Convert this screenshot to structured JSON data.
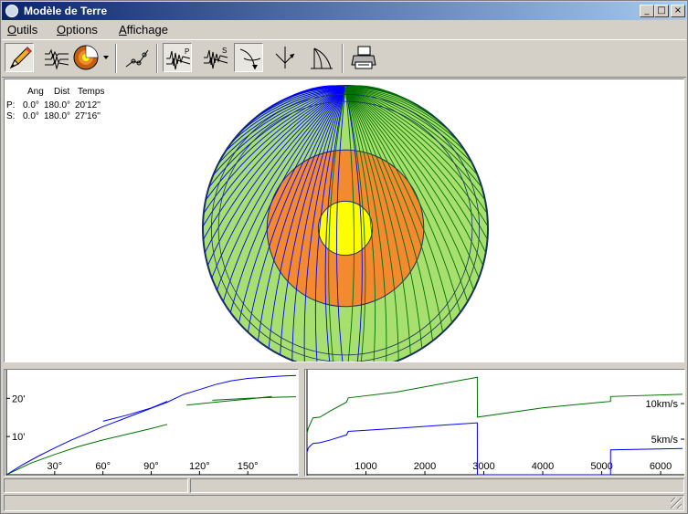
{
  "window": {
    "title": "Modèle de Terre"
  },
  "title_buttons": {
    "minimize": "_",
    "maximize": "□",
    "close": "×"
  },
  "menu": {
    "items": [
      {
        "label": "Outils"
      },
      {
        "label": "Options"
      },
      {
        "label": "Affichage"
      }
    ]
  },
  "toolbar": {
    "buttons": [
      {
        "icon": "pencil-icon"
      },
      {
        "icon": "seismogram-icon"
      },
      {
        "icon": "earth-cross-section-icon"
      },
      {
        "icon": "ray-fit-icon"
      },
      {
        "icon": "seismogram-p-icon"
      },
      {
        "icon": "seismogram-s-icon"
      },
      {
        "icon": "ray-path-icon"
      },
      {
        "icon": "ray-reflection-icon"
      },
      {
        "icon": "ray-fan-icon"
      },
      {
        "icon": "printer-icon"
      }
    ]
  },
  "info": {
    "header": {
      "ang": "Ang",
      "dist": "Dist",
      "temps": "Temps"
    },
    "rows": [
      {
        "phase": "P:",
        "ang": "0.0°",
        "dist": "180.0°",
        "temps": "20'12''"
      },
      {
        "phase": "S:",
        "ang": "0.0°",
        "dist": "180.0°",
        "temps": "27'16''"
      }
    ]
  },
  "earth_model": {
    "colors": {
      "mantle": "#a8e070",
      "outer_core": "#f48a30",
      "inner_core": "#ffff00",
      "p_rays": "#0000ff",
      "s_rays": "#007000",
      "outline": "#1a3060"
    }
  },
  "chart_data": [
    {
      "type": "line",
      "title": "",
      "x_ticks": [
        "30°",
        "60°",
        "90°",
        "120°",
        "150°"
      ],
      "y_ticks": [
        "10'",
        "20'"
      ],
      "xlim": [
        0,
        180
      ],
      "ylim": [
        0,
        27
      ],
      "series": [
        {
          "color": "#0000ff",
          "points": [
            [
              0,
              0
            ],
            [
              10,
              2.6
            ],
            [
              20,
              4.9
            ],
            [
              30,
              7
            ],
            [
              40,
              9
            ],
            [
              50,
              10.8
            ],
            [
              60,
              12.6
            ],
            [
              70,
              14.2
            ],
            [
              80,
              15.8
            ],
            [
              90,
              17.4
            ],
            [
              100,
              19
            ],
            [
              110,
              21
            ],
            [
              120,
              22.3
            ],
            [
              130,
              23.6
            ],
            [
              140,
              24.6
            ],
            [
              150,
              25.2
            ],
            [
              160,
              25.5
            ],
            [
              170,
              25.8
            ],
            [
              180,
              26
            ]
          ]
        },
        {
          "color": "#0000ff",
          "points": [
            [
              60,
              14
            ],
            [
              75,
              15.6
            ],
            [
              90,
              17.5
            ],
            [
              100,
              19.2
            ]
          ]
        },
        {
          "color": "#007000",
          "points": [
            [
              0,
              0
            ],
            [
              15,
              3
            ],
            [
              30,
              5.3
            ],
            [
              45,
              7.4
            ],
            [
              60,
              9.1
            ],
            [
              75,
              10.6
            ],
            [
              90,
              12.1
            ],
            [
              100,
              13.2
            ]
          ]
        },
        {
          "color": "#007000",
          "points": [
            [
              112,
              18.2
            ],
            [
              130,
              19
            ],
            [
              150,
              19.8
            ],
            [
              165,
              20.5
            ]
          ]
        },
        {
          "color": "#007000",
          "points": [
            [
              128,
              19.5
            ],
            [
              150,
              20
            ],
            [
              170,
              20.3
            ],
            [
              180,
              20.4
            ]
          ]
        }
      ]
    },
    {
      "type": "line",
      "title": "",
      "x_ticks": [
        "1000",
        "2000",
        "3000",
        "4000",
        "5000",
        "6000"
      ],
      "y_labels": [
        "10km/s",
        "5km/s"
      ],
      "xlim": [
        0,
        6371
      ],
      "ylim": [
        0,
        14.5
      ],
      "series": [
        {
          "color": "#007000",
          "points": [
            [
              0,
              5.8
            ],
            [
              20,
              6.5
            ],
            [
              35,
              6.8
            ],
            [
              100,
              8.0
            ],
            [
              220,
              8.1
            ],
            [
              400,
              9.0
            ],
            [
              670,
              10.2
            ],
            [
              700,
              10.8
            ],
            [
              1500,
              11.6
            ],
            [
              2890,
              13.7
            ],
            [
              2891,
              8.1
            ],
            [
              4000,
              9.4
            ],
            [
              5000,
              10.2
            ],
            [
              5150,
              10.3
            ],
            [
              5151,
              11.0
            ],
            [
              6371,
              11.3
            ]
          ]
        },
        {
          "color": "#0000ff",
          "points": [
            [
              0,
              3.2
            ],
            [
              20,
              3.7
            ],
            [
              35,
              3.9
            ],
            [
              100,
              4.4
            ],
            [
              220,
              4.5
            ],
            [
              400,
              4.9
            ],
            [
              670,
              5.6
            ],
            [
              700,
              6.1
            ],
            [
              1500,
              6.5
            ],
            [
              2890,
              7.3
            ],
            [
              2891,
              0
            ],
            [
              5150,
              0
            ],
            [
              5151,
              3.5
            ],
            [
              6371,
              3.7
            ]
          ]
        }
      ]
    }
  ]
}
